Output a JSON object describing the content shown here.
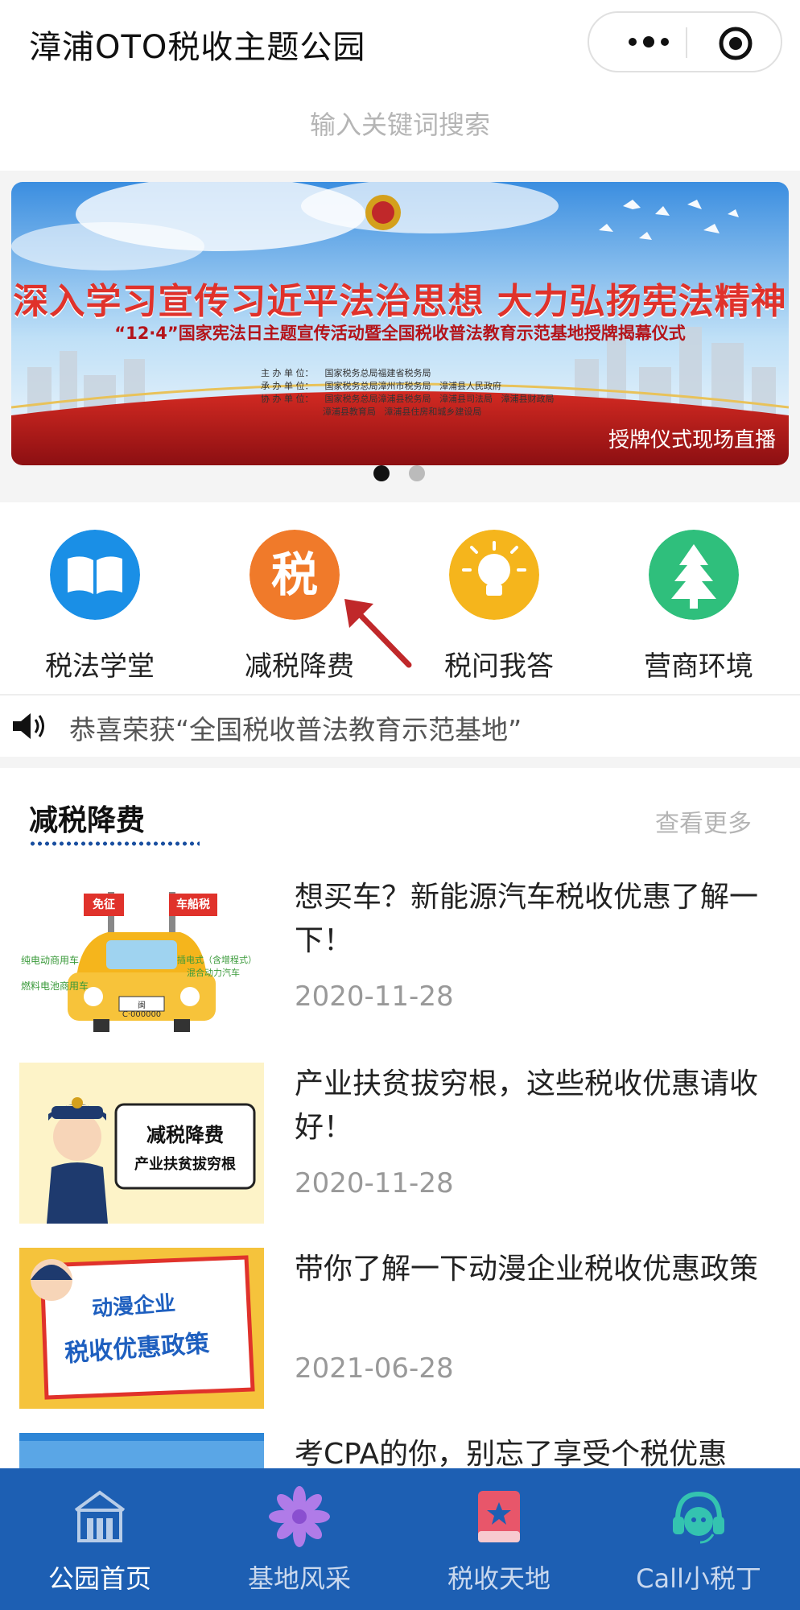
{
  "header": {
    "title": "漳浦OTO税收主题公园"
  },
  "search": {
    "placeholder": "输入关键词搜索"
  },
  "banner": {
    "title": "深入学习宣传习近平法治思想 大力弘扬宪法精神",
    "subtitle": "“12·4”国家宪法日主题宣传活动暨全国税收普法教育示范基地授牌揭幕仪式",
    "organizers": "主 办 单 位：    国家税务总局福建省税务局\n承 办 单 位：    国家税务总局漳州市税务局   漳浦县人民政府\n协 办 单 位：    国家税务总局漳浦县税务局   漳浦县司法局   漳浦县财政局\n                      漳浦县教育局   漳浦县住房和城乡建设局",
    "live_label": "授牌仪式现场直播"
  },
  "quicknav": [
    {
      "label": "税法学堂",
      "icon": "book-icon",
      "color": "#1a8fe6"
    },
    {
      "label": "减税降费",
      "icon": "tax-character-icon",
      "color": "#f07a2a"
    },
    {
      "label": "税问我答",
      "icon": "lightbulb-icon",
      "color": "#f5b51c"
    },
    {
      "label": "营商环境",
      "icon": "tree-icon",
      "color": "#2fbf7c"
    }
  ],
  "notice": {
    "text": "恭喜荣获“全国税收普法教育示范基地”"
  },
  "section": {
    "title": "减税降费",
    "more": "查看更多"
  },
  "articles": [
    {
      "title": "想买车？新能源汽车税收优惠了解一下！",
      "date": "2020-11-28",
      "thumb": {
        "tag1": "免征",
        "tag2": "车船税",
        "l1": "纯电动商用车",
        "l2": "燃料电池商用车",
        "r1": "插电式（含增程式）",
        "r2": "混合动力汽车",
        "plate": "闽C·000000"
      }
    },
    {
      "title": "产业扶贫拔穷根，这些税收优惠请收好！",
      "date": "2020-11-28",
      "thumb": {
        "box1": "减税降费",
        "box2": "产业扶贫拔穷根"
      }
    },
    {
      "title": "带你了解一下动漫企业税收优惠政策",
      "date": "2021-06-28",
      "thumb": {
        "t1": "动漫企业",
        "t2": "税收优惠政策"
      }
    },
    {
      "title": "考CPA的你，别忘了享受个税优惠",
      "date": ""
    }
  ],
  "tabbar": [
    {
      "label": "公园首页",
      "icon": "building-icon",
      "active": true
    },
    {
      "label": "基地风采",
      "icon": "flower-icon",
      "active": false
    },
    {
      "label": "税收天地",
      "icon": "book-star-icon",
      "active": false
    },
    {
      "label": "Call小税丁",
      "icon": "headset-icon",
      "active": false
    }
  ],
  "colors": {
    "tabbar": "#1d5fb3",
    "accent_dots": "#1a4fa0",
    "arrow": "#c0282a"
  }
}
